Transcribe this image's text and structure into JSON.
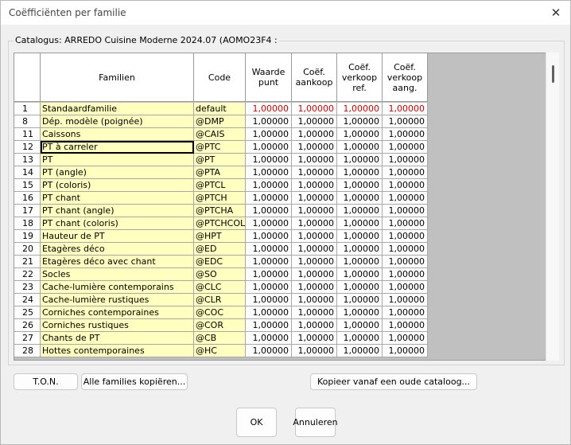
{
  "window": {
    "title": "Coëfficiënten per familie"
  },
  "catalog_label": "Catalogus: ARREDO Cuisine Moderne 2024.07 (AOMO23F4 :",
  "headers": {
    "families": "Familien",
    "code": "Code",
    "v1": "Waarde punt",
    "v2": "Coëf. aankoop",
    "v3": "Coëf. verkoop ref.",
    "v4": "Coëf. verkoop aang."
  },
  "rows": [
    {
      "num": "1",
      "family": "Standaardfamilie",
      "code": "default",
      "v1": "1,00000",
      "v2": "1,00000",
      "v3": "1,00000",
      "v4": "1,00000"
    },
    {
      "num": "8",
      "family": "Dép. modèle (poignée)",
      "code": "@DMP",
      "v1": "1,00000",
      "v2": "1,00000",
      "v3": "1,00000",
      "v4": "1,00000"
    },
    {
      "num": "11",
      "family": "Caissons",
      "code": "@CAIS",
      "v1": "1,00000",
      "v2": "1,00000",
      "v3": "1,00000",
      "v4": "1,00000"
    },
    {
      "num": "12",
      "family": "PT à carreler",
      "code": "@PTC",
      "v1": "1,00000",
      "v2": "1,00000",
      "v3": "1,00000",
      "v4": "1,00000"
    },
    {
      "num": "13",
      "family": "PT",
      "code": "@PT",
      "v1": "1,00000",
      "v2": "1,00000",
      "v3": "1,00000",
      "v4": "1,00000"
    },
    {
      "num": "14",
      "family": "PT (angle)",
      "code": "@PTA",
      "v1": "1,00000",
      "v2": "1,00000",
      "v3": "1,00000",
      "v4": "1,00000"
    },
    {
      "num": "15",
      "family": "PT (coloris)",
      "code": "@PTCL",
      "v1": "1,00000",
      "v2": "1,00000",
      "v3": "1,00000",
      "v4": "1,00000"
    },
    {
      "num": "16",
      "family": "PT chant",
      "code": "@PTCH",
      "v1": "1,00000",
      "v2": "1,00000",
      "v3": "1,00000",
      "v4": "1,00000"
    },
    {
      "num": "17",
      "family": "PT chant (angle)",
      "code": "@PTCHA",
      "v1": "1,00000",
      "v2": "1,00000",
      "v3": "1,00000",
      "v4": "1,00000"
    },
    {
      "num": "18",
      "family": "PT chant (coloris)",
      "code": "@PTCHCOL",
      "v1": "1,00000",
      "v2": "1,00000",
      "v3": "1,00000",
      "v4": "1,00000"
    },
    {
      "num": "19",
      "family": "Hauteur de PT",
      "code": "@HPT",
      "v1": "1,00000",
      "v2": "1,00000",
      "v3": "1,00000",
      "v4": "1,00000"
    },
    {
      "num": "20",
      "family": "Etagères déco",
      "code": "@ED",
      "v1": "1,00000",
      "v2": "1,00000",
      "v3": "1,00000",
      "v4": "1,00000"
    },
    {
      "num": "21",
      "family": "Etagères déco avec chant",
      "code": "@EDC",
      "v1": "1,00000",
      "v2": "1,00000",
      "v3": "1,00000",
      "v4": "1,00000"
    },
    {
      "num": "22",
      "family": "Socles",
      "code": "@SO",
      "v1": "1,00000",
      "v2": "1,00000",
      "v3": "1,00000",
      "v4": "1,00000"
    },
    {
      "num": "23",
      "family": "Cache-lumière contemporains",
      "code": "@CLC",
      "v1": "1,00000",
      "v2": "1,00000",
      "v3": "1,00000",
      "v4": "1,00000"
    },
    {
      "num": "24",
      "family": "Cache-lumière rustiques",
      "code": "@CLR",
      "v1": "1,00000",
      "v2": "1,00000",
      "v3": "1,00000",
      "v4": "1,00000"
    },
    {
      "num": "25",
      "family": "Corniches contemporaines",
      "code": "@COC",
      "v1": "1,00000",
      "v2": "1,00000",
      "v3": "1,00000",
      "v4": "1,00000"
    },
    {
      "num": "26",
      "family": "Corniches rustiques",
      "code": "@COR",
      "v1": "1,00000",
      "v2": "1,00000",
      "v3": "1,00000",
      "v4": "1,00000"
    },
    {
      "num": "27",
      "family": "Chants de PT",
      "code": "@CB",
      "v1": "1,00000",
      "v2": "1,00000",
      "v3": "1,00000",
      "v4": "1,00000"
    },
    {
      "num": "28",
      "family": "Hottes contemporaines",
      "code": "@HC",
      "v1": "1,00000",
      "v2": "1,00000",
      "v3": "1,00000",
      "v4": "1,00000"
    }
  ],
  "buttons": {
    "ton": "T.O.N.",
    "copy_all": "Alle families kopiëren...",
    "copy_old": "Kopieer vanaf een oude cataloog...",
    "ok": "OK",
    "cancel": "Annuleren"
  },
  "colors": {
    "family_bg": "#ffffc0",
    "first_row_text": "#c00000",
    "grid_bg": "#c0c0c0"
  },
  "selected_row_num": "12"
}
